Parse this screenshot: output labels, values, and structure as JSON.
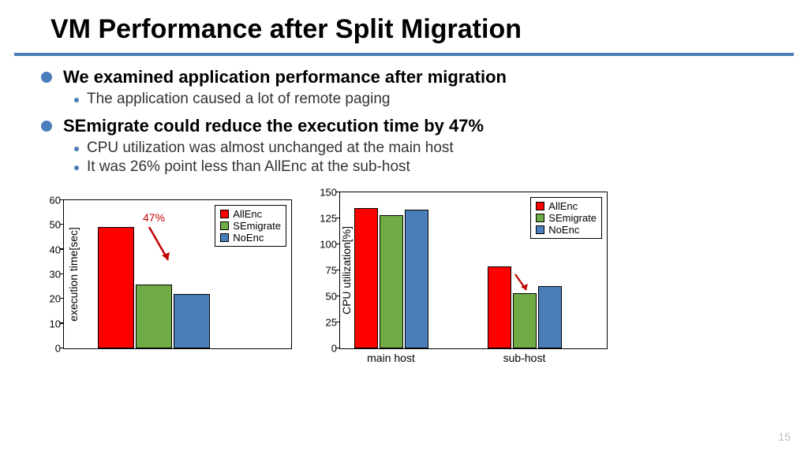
{
  "title": "VM Performance after Split Migration",
  "bullets": [
    {
      "text": "We examined application performance after migration",
      "sub": [
        "The application caused a lot of remote paging"
      ]
    },
    {
      "text": "SEmigrate could reduce the execution time by 47%",
      "sub": [
        "CPU utilization was almost unchanged at the main host",
        "It was 26% point less than AllEnc at the sub-host"
      ]
    }
  ],
  "legend": {
    "allenc": "AllEnc",
    "semig": "SEmigrate",
    "noenc": "NoEnc"
  },
  "annotation": "47%",
  "page": "15",
  "chart_data": [
    {
      "type": "bar",
      "title": "",
      "ylabel": "execution time[sec]",
      "xlabel": "",
      "ylim": [
        0,
        60
      ],
      "yticks": [
        0,
        10,
        20,
        30,
        40,
        50,
        60
      ],
      "categories": [
        ""
      ],
      "series": [
        {
          "name": "AllEnc",
          "values": [
            49
          ]
        },
        {
          "name": "SEmigrate",
          "values": [
            26
          ]
        },
        {
          "name": "NoEnc",
          "values": [
            22
          ]
        }
      ],
      "annotation": "47%"
    },
    {
      "type": "bar",
      "title": "",
      "ylabel": "CPU utilization[%]",
      "xlabel": "",
      "ylim": [
        0,
        150
      ],
      "yticks": [
        0,
        25,
        50,
        75,
        100,
        125,
        150
      ],
      "categories": [
        "main host",
        "sub-host"
      ],
      "series": [
        {
          "name": "AllEnc",
          "values": [
            135,
            79
          ]
        },
        {
          "name": "SEmigrate",
          "values": [
            128,
            53
          ]
        },
        {
          "name": "NoEnc",
          "values": [
            133,
            60
          ]
        }
      ]
    }
  ]
}
